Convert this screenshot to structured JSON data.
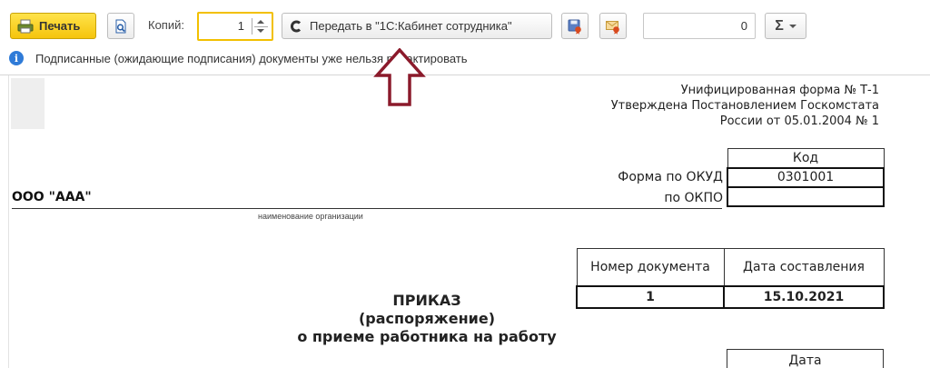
{
  "toolbar": {
    "print_label": "Печать",
    "copies_label": "Копий:",
    "copies_value": "1",
    "send_label": "Передать в \"1С:Кабинет сотрудника\"",
    "sum_value": "0",
    "sigma_label": "Σ"
  },
  "info": {
    "message": "Подписанные (ожидающие подписания) документы уже нельзя редактировать"
  },
  "document": {
    "unified_form": [
      "Унифицированная форма № Т-1",
      "Утверждена Постановлением Госкомстата",
      "России от 05.01.2004 № 1"
    ],
    "code_header": "Код",
    "okud_label": "Форма по ОКУД",
    "okud_value": "0301001",
    "okpo_label": "по ОКПО",
    "okpo_value": "",
    "organization": "ООО \"ААА\"",
    "organization_caption": "наименование организации",
    "doc_number_header": "Номер документа",
    "doc_date_header": "Дата составления",
    "doc_number": "1",
    "doc_date": "15.10.2021",
    "title": [
      "ПРИКАЗ",
      "(распоряжение)",
      "о приеме работника на работу"
    ],
    "date_header": "Дата"
  },
  "colors": {
    "print_button": "#f5c40c",
    "copies_border": "#f2c000",
    "info_icon": "#2f7bd8",
    "arrow": "#8b1a2b"
  }
}
